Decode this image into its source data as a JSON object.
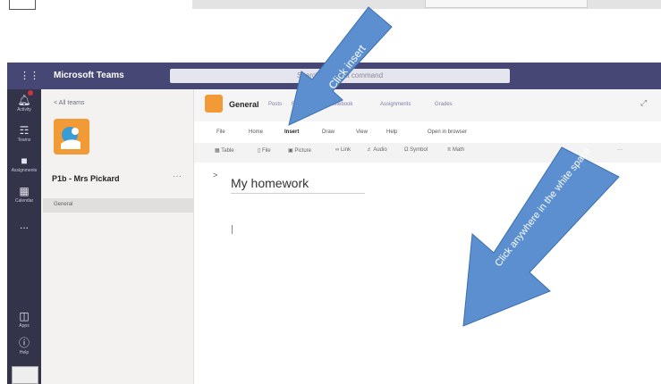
{
  "app": {
    "title": "Microsoft Teams",
    "search_placeholder": "Search or type a command"
  },
  "rail": {
    "items": [
      {
        "icon": "bell-icon",
        "label": "Activity"
      },
      {
        "icon": "teams-icon",
        "label": "Teams"
      },
      {
        "icon": "backpack-icon",
        "label": "Assignments"
      },
      {
        "icon": "calendar-icon",
        "label": "Calendar"
      },
      {
        "icon": "more-icon",
        "label": "..."
      }
    ],
    "bottom": [
      {
        "icon": "apps-icon",
        "label": "Apps"
      },
      {
        "icon": "help-icon",
        "label": "Help"
      }
    ]
  },
  "team_panel": {
    "back_label": "< All teams",
    "team_name": "P1b - Mrs Pickard",
    "more": "···",
    "channels": [
      "General"
    ]
  },
  "channel": {
    "title": "General",
    "tabs": [
      "Posts",
      "Files",
      "Class Notebook",
      "Assignments",
      "Grades"
    ]
  },
  "ribbon": {
    "tabs": [
      "File",
      "Home",
      "Insert",
      "Draw",
      "View",
      "Help",
      "Open in browser"
    ],
    "tools": [
      "Table",
      "File",
      "Picture",
      "Link",
      "Audio",
      "Symbol",
      "Math"
    ]
  },
  "page": {
    "title": "My homework",
    "expander": ">"
  },
  "callouts": {
    "insert": "Click insert",
    "white_space": "Click anywhere in the white space"
  },
  "colors": {
    "teams_purple": "#464775",
    "rail": "#33344a",
    "callout_blue": "#5b8fd0",
    "orange": "#f29a35"
  }
}
